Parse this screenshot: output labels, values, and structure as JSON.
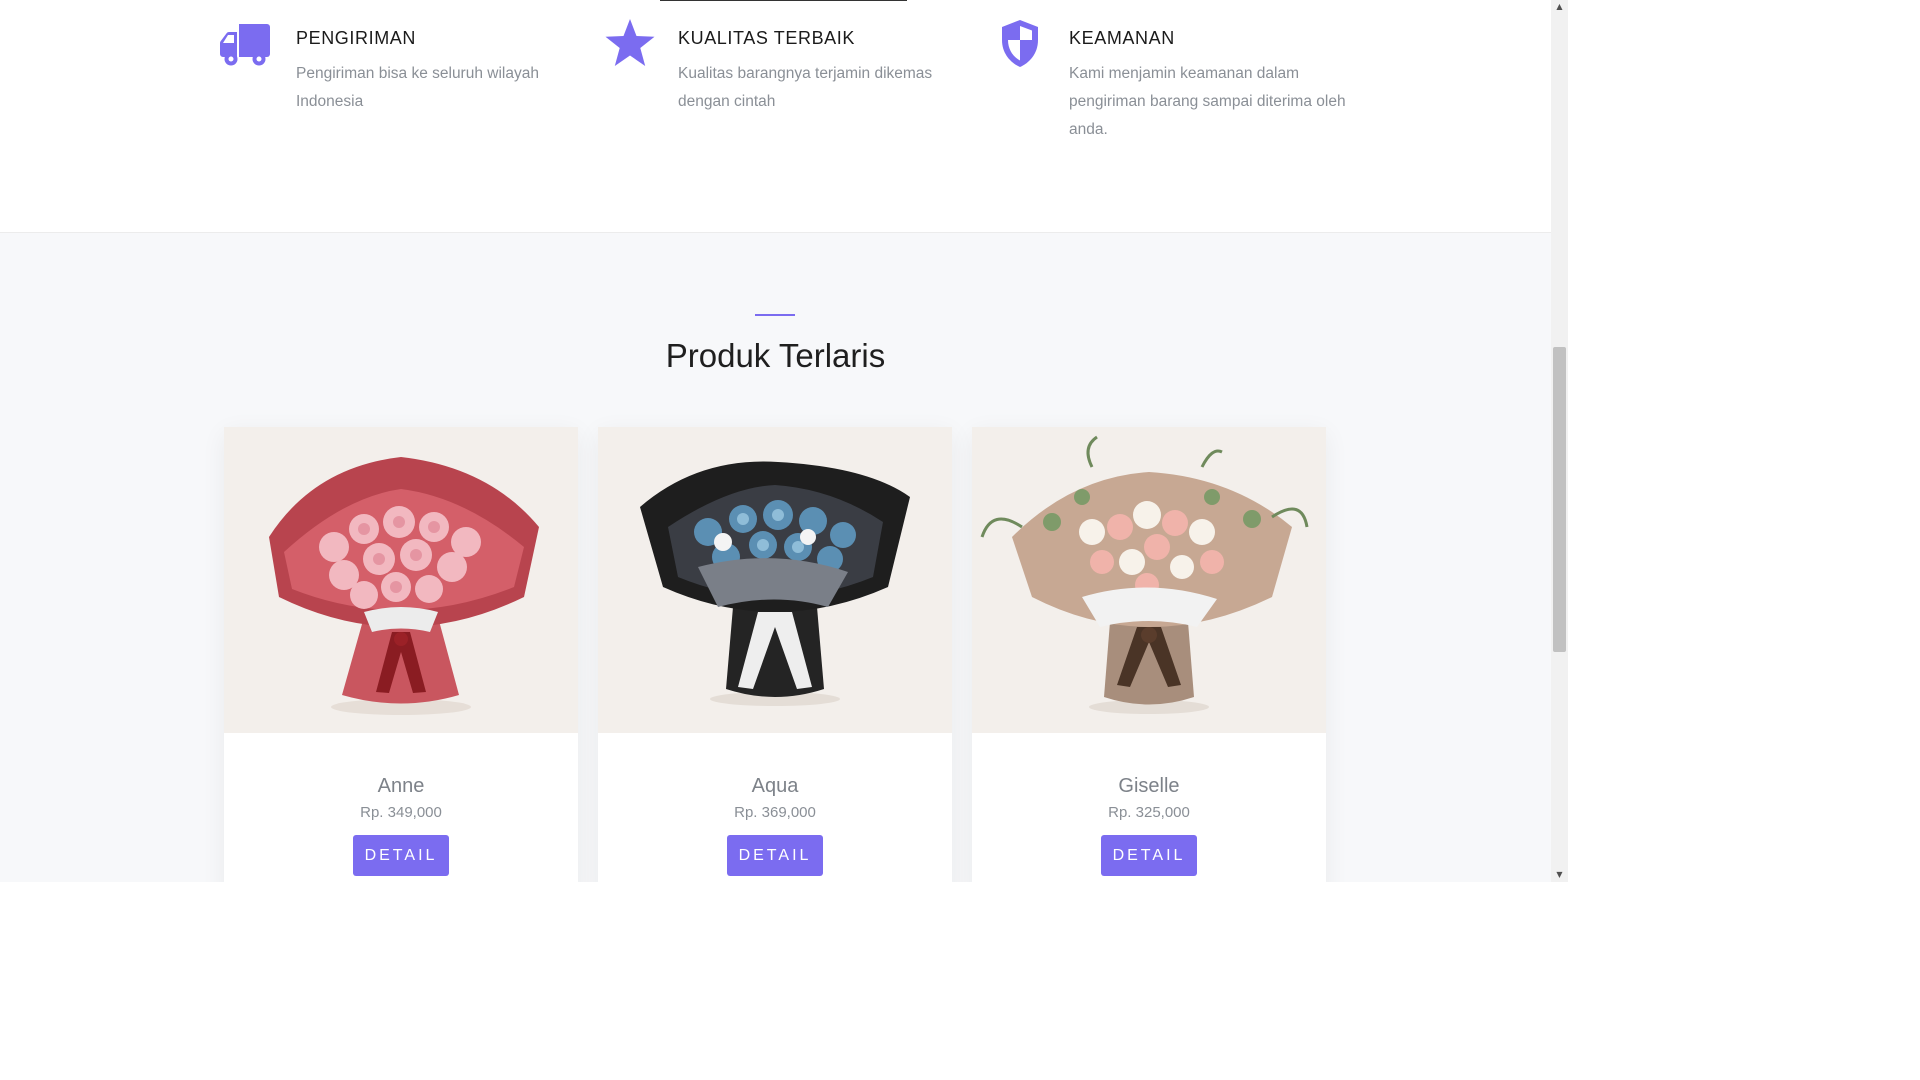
{
  "features": [
    {
      "icon": "truck-icon",
      "title": "PENGIRIMAN",
      "desc": "Pengiriman bisa ke seluruh wilayah Indonesia"
    },
    {
      "icon": "star-icon",
      "title": "KUALITAS TERBAIK",
      "desc": "Kualitas barangnya terjamin dikemas dengan cintah"
    },
    {
      "icon": "shield-icon",
      "title": "KEAMANAN",
      "desc": "Kami menjamin keamanan dalam pengiriman barang sampai diterima oleh anda."
    }
  ],
  "section": {
    "title": "Produk Terlaris"
  },
  "products": [
    {
      "name": "Anne",
      "price": "Rp. 349,000",
      "button": "DETAIL",
      "image": "pink-bouquet"
    },
    {
      "name": "Aqua",
      "price": "Rp. 369,000",
      "button": "DETAIL",
      "image": "blue-black-bouquet"
    },
    {
      "name": "Giselle",
      "price": "Rp. 325,000",
      "button": "DETAIL",
      "image": "pastel-bouquet"
    }
  ],
  "colors": {
    "accent": "#7b6cf0",
    "background": "#f7f8fa",
    "text_muted": "#8a8f96"
  }
}
